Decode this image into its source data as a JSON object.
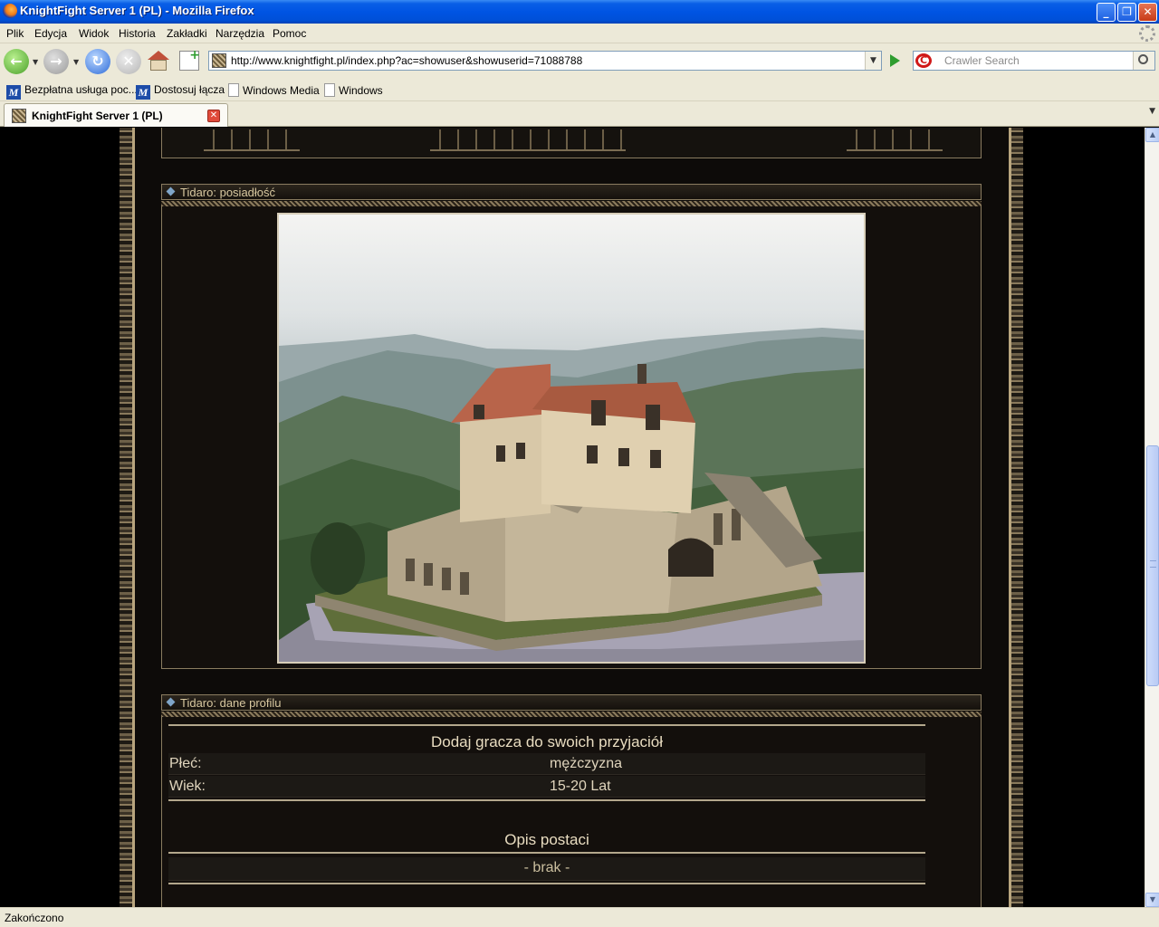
{
  "window": {
    "title": "KnightFight Server 1 (PL) - Mozilla Firefox"
  },
  "menu": {
    "items": [
      "Plik",
      "Edycja",
      "Widok",
      "Historia",
      "Zakładki",
      "Narzędzia",
      "Pomoc"
    ]
  },
  "nav": {
    "url": "http://www.knightfight.pl/index.php?ac=showuser&showuserid=71088788",
    "search_placeholder": "Crawler Search"
  },
  "bookmarks": [
    "Bezpłatna usługa poc...",
    "Dostosuj łącza",
    "Windows Media",
    "Windows"
  ],
  "tabs": [
    {
      "label": "KnightFight Server 1 (PL)"
    }
  ],
  "page": {
    "estate_panel_title": "Tidaro: posiadłość",
    "profile_panel_title": "Tidaro: dane profilu",
    "add_friend": "Dodaj gracza do swoich przyjaciół",
    "rows": [
      {
        "label": "Płeć:",
        "value": "mężczyzna"
      },
      {
        "label": "Wiek:",
        "value": "15-20 Lat"
      }
    ],
    "description_heading": "Opis postaci",
    "description_value": "- brak -"
  },
  "status": {
    "text": "Zakończono"
  }
}
